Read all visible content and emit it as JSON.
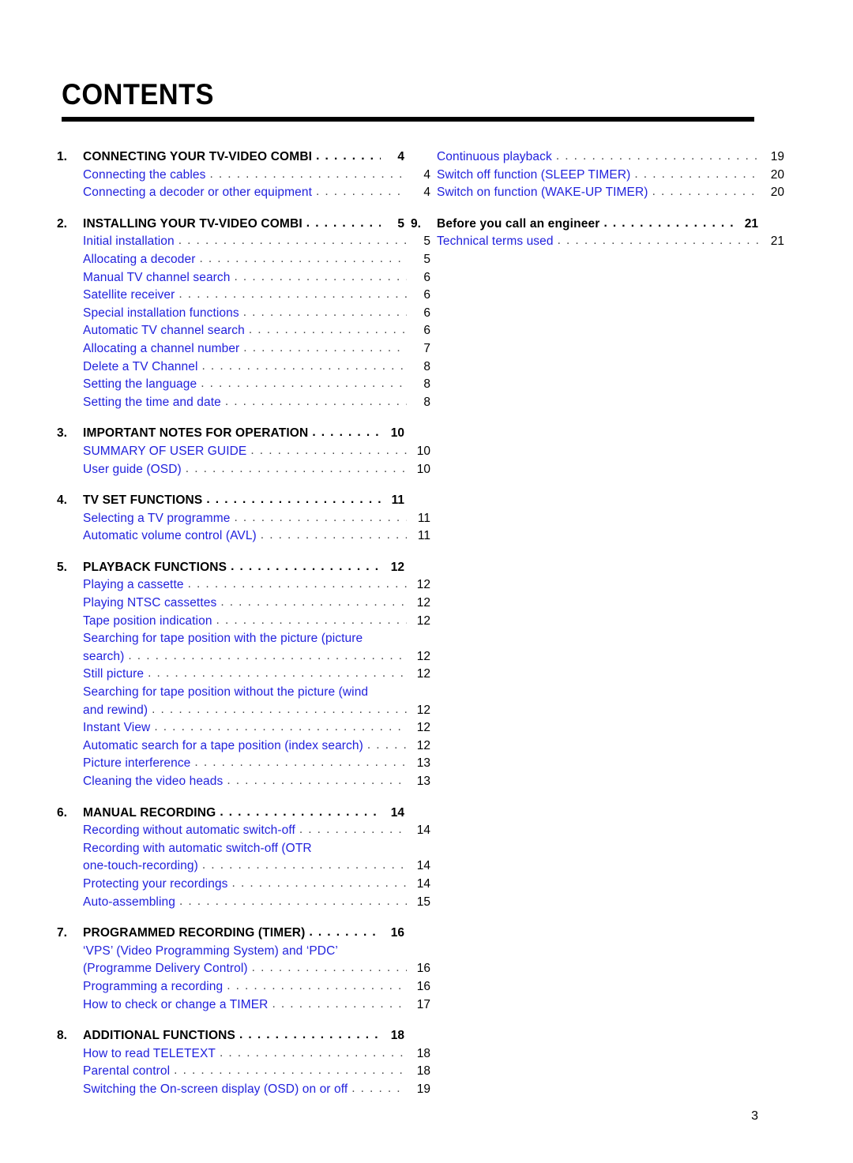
{
  "document": {
    "title": "CONTENTS",
    "folio": "3",
    "accent_blue": "#2222DD",
    "heading_color": "#000000",
    "leader_char": "."
  },
  "columns": {
    "left": [
      {
        "number": "1.",
        "heading": "CONNECTING YOUR TV-VIDEO COMBI",
        "heading_page": "4",
        "entries": [
          {
            "label": "Connecting the cables",
            "page": "4"
          },
          {
            "label": "Connecting a decoder or other equipment",
            "page": "4"
          }
        ]
      },
      {
        "number": "2.",
        "heading": "INSTALLING YOUR TV-VIDEO COMBI",
        "heading_page": "5",
        "entries": [
          {
            "label": "Initial installation",
            "page": "5"
          },
          {
            "label": "Allocating a decoder",
            "page": "5"
          },
          {
            "label": "Manual TV channel search",
            "page": "6"
          },
          {
            "label": "Satellite receiver",
            "page": "6"
          },
          {
            "label": "Special installation functions",
            "page": "6"
          },
          {
            "label": "Automatic TV channel search",
            "page": "6"
          },
          {
            "label": "Allocating a channel number",
            "page": "7"
          },
          {
            "label": "Delete a TV Channel",
            "page": "8"
          },
          {
            "label": "Setting the language",
            "page": "8"
          },
          {
            "label": "Setting the time and date",
            "page": "8"
          }
        ]
      },
      {
        "number": "3.",
        "heading": "IMPORTANT NOTES FOR OPERATION",
        "heading_page": "10",
        "entries": [
          {
            "label": "SUMMARY OF USER GUIDE",
            "page": "10"
          },
          {
            "label": "User guide (OSD)",
            "page": "10"
          }
        ]
      },
      {
        "number": "4.",
        "heading": "TV SET FUNCTIONS",
        "heading_page": "11",
        "entries": [
          {
            "label": "Selecting a TV programme",
            "page": "11"
          },
          {
            "label": "Automatic volume control (AVL)",
            "page": "11"
          }
        ]
      },
      {
        "number": "5.",
        "heading": "PLAYBACK FUNCTIONS",
        "heading_page": "12",
        "entries": [
          {
            "label": "Playing a cassette",
            "page": "12"
          },
          {
            "label": "Playing NTSC cassettes",
            "page": "12"
          },
          {
            "label": "Tape position indication",
            "page": "12"
          },
          {
            "label": "Searching for tape position with the picture (picture",
            "page": "",
            "wrap_first": true
          },
          {
            "label": "search)",
            "page": "12"
          },
          {
            "label": "Still picture",
            "page": "12"
          },
          {
            "label": "Searching for tape position without the picture (wind",
            "page": "",
            "wrap_first": true
          },
          {
            "label": "and rewind)",
            "page": "12"
          },
          {
            "label": "Instant View",
            "page": "12"
          },
          {
            "label": "Automatic search for a tape position (index search)",
            "page": "12"
          },
          {
            "label": "Picture interference",
            "page": "13"
          },
          {
            "label": "Cleaning the video heads",
            "page": "13"
          }
        ]
      },
      {
        "number": "6.",
        "heading": "MANUAL RECORDING",
        "heading_page": "14",
        "entries": [
          {
            "label": "Recording without automatic switch-off",
            "page": "14"
          },
          {
            "label": "Recording with automatic switch-off (OTR",
            "page": "",
            "wrap_first": true
          },
          {
            "label": "one-touch-recording)",
            "page": "14"
          },
          {
            "label": "Protecting your recordings",
            "page": "14"
          },
          {
            "label": "Auto-assembling",
            "page": "15"
          }
        ]
      },
      {
        "number": "7.",
        "heading": "PROGRAMMED RECORDING (TIMER)",
        "heading_page": "16",
        "entries": [
          {
            "label": "‘VPS’ (Video Programming System) and ‘PDC’",
            "page": "",
            "wrap_first": true
          },
          {
            "label": "(Programme Delivery Control)",
            "page": "16"
          },
          {
            "label": "Programming a recording",
            "page": "16"
          },
          {
            "label": "How to check or change a TIMER",
            "page": "17"
          }
        ]
      },
      {
        "number": "8.",
        "heading": "ADDITIONAL FUNCTIONS",
        "heading_page": "18",
        "entries": [
          {
            "label": "How to read TELETEXT",
            "page": "18"
          },
          {
            "label": "Parental control",
            "page": "18"
          },
          {
            "label": "Switching the On-screen display (OSD) on or off",
            "page": "19"
          }
        ]
      }
    ],
    "right": [
      {
        "number": "",
        "heading": "",
        "heading_page": "",
        "entries": [
          {
            "label": "Continuous playback",
            "page": "19"
          },
          {
            "label": "Switch off function (SLEEP TIMER)",
            "page": "20"
          },
          {
            "label": "Switch on function (WAKE-UP TIMER)",
            "page": "20"
          }
        ]
      },
      {
        "number": "9.",
        "heading": "Before you call an engineer",
        "heading_page": "21",
        "entries": [
          {
            "label": "Technical terms used",
            "page": "21"
          }
        ]
      }
    ]
  }
}
